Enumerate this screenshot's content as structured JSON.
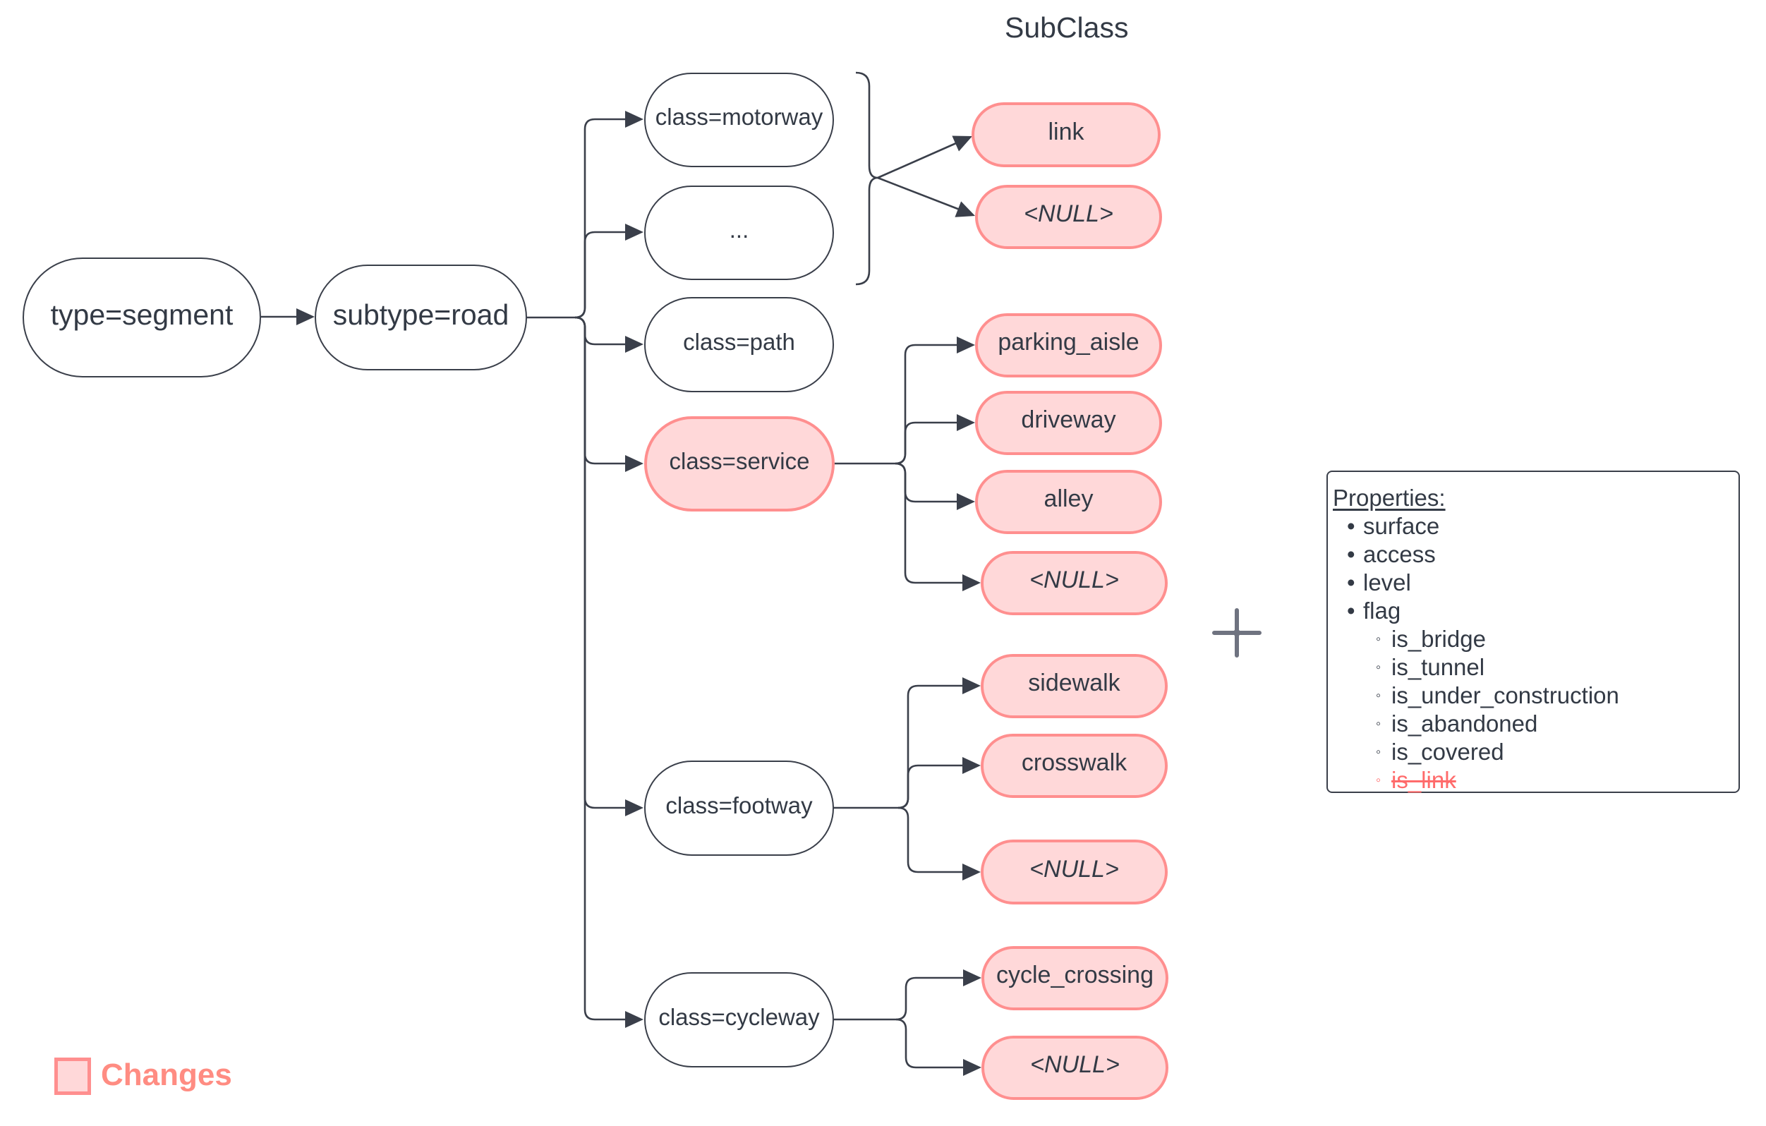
{
  "title": "SubClass",
  "colors": {
    "change_fill": "#ffd8d9",
    "change_stroke": "#ff8f8f",
    "removed_text": "#ff6b6b",
    "line": "#3a3f4a",
    "text": "#333a45"
  },
  "nodes": {
    "type": {
      "label": "type=segment"
    },
    "subtype": {
      "label": "subtype=road"
    },
    "classes": [
      {
        "id": "motorway",
        "label": "class=motorway",
        "changed": false
      },
      {
        "id": "ellipsis",
        "label": "...",
        "changed": false
      },
      {
        "id": "path",
        "label": "class=path",
        "changed": false
      },
      {
        "id": "service",
        "label": "class=service",
        "changed": true
      },
      {
        "id": "footway",
        "label": "class=footway",
        "changed": false
      },
      {
        "id": "cycleway",
        "label": "class=cycleway",
        "changed": false
      }
    ],
    "subclasses": [
      {
        "id": "link",
        "label": "link",
        "parent": "motorway-group",
        "changed": true
      },
      {
        "id": "null-1",
        "label": "<NULL>",
        "parent": "motorway-group",
        "changed": true,
        "italic": true
      },
      {
        "id": "parking-aisle",
        "label": "parking_aisle",
        "parent": "service",
        "changed": true
      },
      {
        "id": "driveway",
        "label": "driveway",
        "parent": "service",
        "changed": true
      },
      {
        "id": "alley",
        "label": "alley",
        "parent": "service",
        "changed": true
      },
      {
        "id": "null-2",
        "label": "<NULL>",
        "parent": "service",
        "changed": true,
        "italic": true
      },
      {
        "id": "sidewalk",
        "label": "sidewalk",
        "parent": "footway",
        "changed": true
      },
      {
        "id": "crosswalk",
        "label": "crosswalk",
        "parent": "footway",
        "changed": true
      },
      {
        "id": "null-3",
        "label": "<NULL>",
        "parent": "footway",
        "changed": true,
        "italic": true
      },
      {
        "id": "cycle-crossing",
        "label": "cycle_crossing",
        "parent": "cycleway",
        "changed": true
      },
      {
        "id": "null-4",
        "label": "<NULL>",
        "parent": "cycleway",
        "changed": true,
        "italic": true
      }
    ]
  },
  "properties": {
    "heading": "Properties:",
    "items": [
      {
        "label": "surface",
        "level": 1,
        "bullet": "•"
      },
      {
        "label": "access",
        "level": 1,
        "bullet": "•"
      },
      {
        "label": "level",
        "level": 1,
        "bullet": "•"
      },
      {
        "label": "flag",
        "level": 1,
        "bullet": "•"
      },
      {
        "label": "is_bridge",
        "level": 2,
        "bullet": "◦"
      },
      {
        "label": "is_tunnel",
        "level": 2,
        "bullet": "◦"
      },
      {
        "label": "is_under_construction",
        "level": 2,
        "bullet": "◦"
      },
      {
        "label": "is_abandoned",
        "level": 2,
        "bullet": "◦"
      },
      {
        "label": "is_covered",
        "level": 2,
        "bullet": "◦"
      },
      {
        "label": "is_link",
        "level": 2,
        "bullet": "◦",
        "removed": true
      }
    ]
  },
  "combine_icon": "plus-icon",
  "legend": {
    "label": "Changes"
  }
}
